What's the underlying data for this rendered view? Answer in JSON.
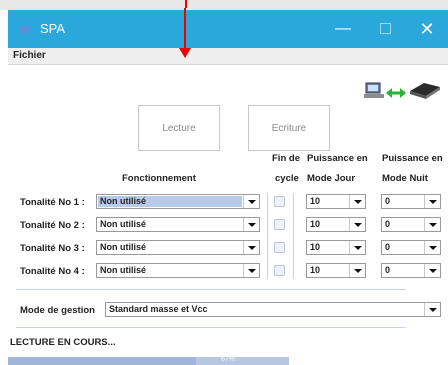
{
  "window": {
    "title": "SPA",
    "min": "—",
    "close": "✕"
  },
  "menu": {
    "fichier": "Fichier"
  },
  "buttons": {
    "lecture": "Lecture",
    "ecriture": "Ecriture"
  },
  "headers": {
    "fonctionnement": "Fonctionnement",
    "fin_de": "Fin de",
    "cycle": "cycle",
    "puissance_jour_1": "Puissance en",
    "puissance_jour_2": "Mode Jour",
    "puissance_nuit_1": "Puissance en",
    "puissance_nuit_2": "Mode Nuit"
  },
  "rows": [
    {
      "label": "Tonalité No 1 :",
      "fonctionnement": "Non utilisé",
      "jour": "10",
      "nuit": "0"
    },
    {
      "label": "Tonalité No 2 :",
      "fonctionnement": "Non utilisé",
      "jour": "10",
      "nuit": "0"
    },
    {
      "label": "Tonalité No 3 :",
      "fonctionnement": "Non utilisé",
      "jour": "10",
      "nuit": "0"
    },
    {
      "label": "Tonalité No 4 :",
      "fonctionnement": "Non utilisé",
      "jour": "10",
      "nuit": "0"
    }
  ],
  "mode_gestion": {
    "label": "Mode de gestion",
    "value": "Standard masse et Vcc"
  },
  "status": {
    "text": "LECTURE EN COURS...",
    "progress_text": "67%",
    "progress_fraction": 0.67
  },
  "colors": {
    "titlebar": "#2aa8dc",
    "arrow": "#e00000",
    "selection": "#b9c9e8",
    "progress": "#b7c6e3"
  }
}
